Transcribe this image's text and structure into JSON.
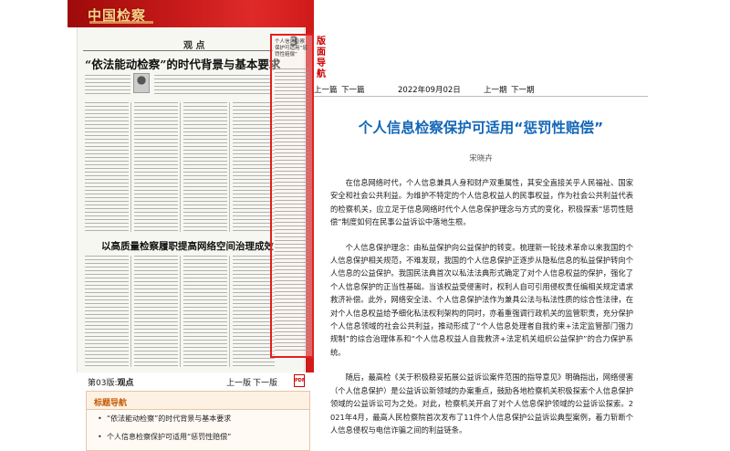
{
  "newspaper": {
    "brand": "中国检察",
    "section_label": "观 点",
    "page_number": "3",
    "headline_1": "“依法能动检察”的时代背景与基本要求",
    "headline_2": "以高质量检察履职提高网络空间治理成效",
    "highlight_title": "个人信息检察保护可适用“惩罚性赔偿”"
  },
  "page_nav": {
    "edition_prefix": "第03版:",
    "edition_name": "观点",
    "prev_page": "上一版",
    "next_page": "下一版",
    "pdf_icon": "pdf-icon"
  },
  "toc": {
    "header": "标题导航",
    "items": [
      "“依法能动检察”的时代背景与基本要求",
      "个人信息检察保护可适用“惩罚性赔偿”"
    ]
  },
  "side_label": "版面导航",
  "article_nav": {
    "prev_article": "上一篇",
    "next_article": "下一篇",
    "date": "2022年09月02日",
    "prev_issue": "上一期",
    "next_issue": "下一期"
  },
  "article": {
    "title": "个人信息检察保护可适用“惩罚性赔偿”",
    "author": "宋晓卉",
    "paragraphs": [
      "在信息网络时代，个人信息兼具人身和财产双重属性，其安全直接关乎人民福祉、国家安全和社会公共利益。为维护不特定的个人信息权益人的民事权益，作为社会公共利益代表的检察机关，应立足于信息网络时代个人信息保护理念与方式的变化，积极探索“惩罚性赔偿”制度如何在民事公益诉讼中落地生根。",
      "个人信息保护理念：由私益保护向公益保护的转变。梳理新一轮技术革命以来我国的个人信息保护相关规范，不难发现，我国的个人信息保护正逐步从隐私信息的私益保护转向个人信息的公益保护。我国民法典首次以私法法典形式确定了对个人信息权益的保护，强化了个人信息保护的正当性基础。当该权益受侵害时，权利人自可引用侵权责任编相关规定请求救济补偿。此外，网络安全法、个人信息保护法作为兼具公法与私法性质的综合性法律，在对个人信息权益给予细化私法权利架构的同时，亦着重强调行政机关的监管职责，充分保护个人信息领域的社会公共利益，推动形成了“个人信息处理者自我约束+法定监管部门强力规制”的综合治理体系和“个人信息权益人自我救济+法定机关组织公益保护”的合力保护系统。",
      "随后，最高检《关于积极稳妥拓展公益诉讼案件范围的指导意见》明确指出，网络侵害（个人信息保护）是公益诉讼新领域的办案重点，鼓励各地检察机关积极探索个人信息保护领域的公益诉讼可为之处。对此，检察机关开启了对个人信息保护领域的公益诉讼探索。2021年4月，最高人民检察院首次发布了11件个人信息保护公益诉讼典型案例，着力斩断个人信息侵权与电信诈骗之间的利益链条。"
    ]
  },
  "colors": {
    "header_red": "#c71a1a",
    "title_blue": "#1366b8",
    "highlight_red": "#e02020",
    "toc_orange": "#c65a00"
  }
}
